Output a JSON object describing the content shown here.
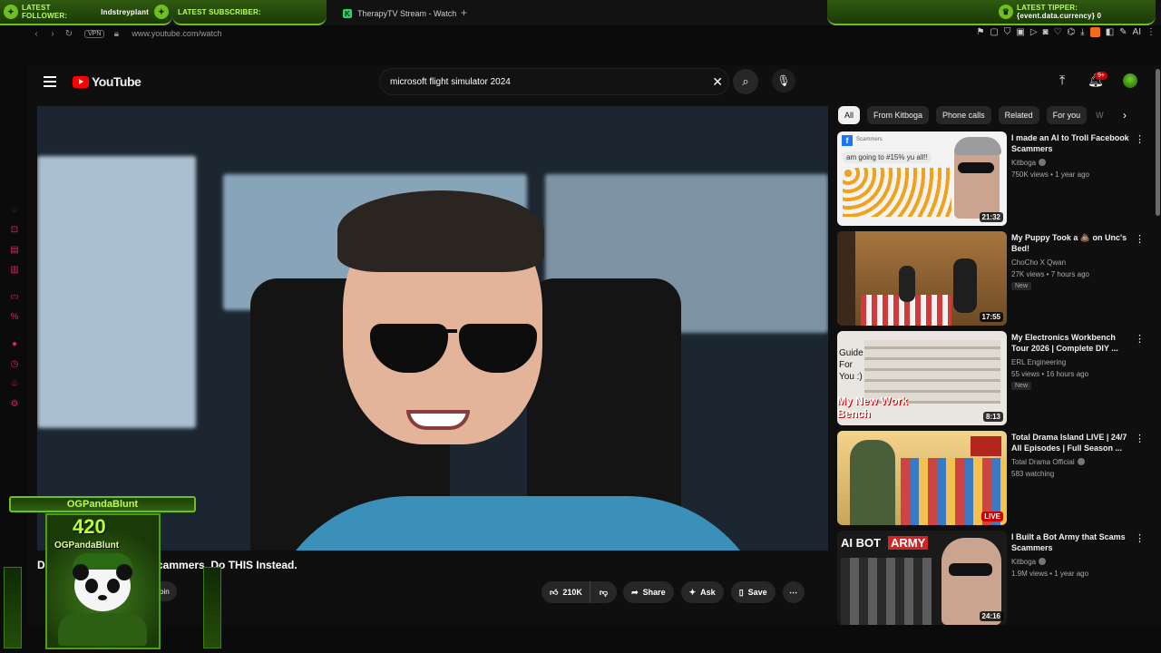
{
  "overlay": {
    "follower_label": "LATEST FOLLOWER:",
    "follower_value": "Indstreyplant",
    "subscriber_label": "LATEST SUBSCRIBER:",
    "subscriber_value": "",
    "tipper_label": "LATEST TIPPER:",
    "tipper_value": "{event.data.currency} 0",
    "panda_name": "OGPandaBlunt",
    "panda_number": "420",
    "panda_sub": "OGPandaBlunt"
  },
  "browser": {
    "tab_title": "TherapyTV Stream - Watch",
    "tab_favicon": "K",
    "url": "www.youtube.com/watch",
    "vpn_label": "VPN",
    "ai_label": "AI"
  },
  "youtube": {
    "logo_text": "YouTube",
    "search_value": "microsoft flight simulator 2024",
    "notif_count": "9+",
    "video": {
      "title_lead": "D",
      "title_rest": "cammers. Do THIS Instead.",
      "join_label": "oin",
      "likes": "210K",
      "share_label": "Share",
      "ask_label": "Ask",
      "save_label": "Save"
    },
    "chips": [
      "All",
      "From Kitboga",
      "Phone calls",
      "Related",
      "For you",
      "W"
    ],
    "recommendations": [
      {
        "title": "I made an AI to Troll Facebook Scammers",
        "channel": "Kitboga",
        "stats": "750K views • 1 year ago",
        "duration": "21:32",
        "badge": "",
        "thumb_text": "am going to #15% yu all!!",
        "thumb_tag": "Scammers"
      },
      {
        "title": "My Puppy Took a 💩 on Unc's Bed!",
        "channel": "ChoCho X Qwan",
        "stats": "27K views • 7 hours ago",
        "duration": "17:55",
        "badge": "New",
        "thumb_text": "",
        "thumb_tag": ""
      },
      {
        "title": "My Electronics Workbench Tour 2026 | Complete DIY ...",
        "channel": "ERL Engineering",
        "stats": "55 views • 16 hours ago",
        "duration": "8:13",
        "badge": "New",
        "thumb_text": "My New Work Bench",
        "thumb_tag": "Guide For You :)"
      },
      {
        "title": "Total Drama Island LIVE | 24/7 All Episodes | Full Season ...",
        "channel": "Total Drama Official",
        "stats": "583 watching",
        "duration": "LIVE",
        "badge": "",
        "thumb_text": "",
        "thumb_tag": ""
      },
      {
        "title": "I Built a Bot Army that Scams Scammers",
        "channel": "Kitboga",
        "stats": "1.9M views • 1 year ago",
        "duration": "24:16",
        "badge": "",
        "thumb_text": "AI BOT",
        "thumb_tag": "ARMY"
      }
    ]
  },
  "colors": {
    "accent_green": "#6fbf1f",
    "yt_red": "#ff0000",
    "yt_bg": "#0f0f0f"
  }
}
